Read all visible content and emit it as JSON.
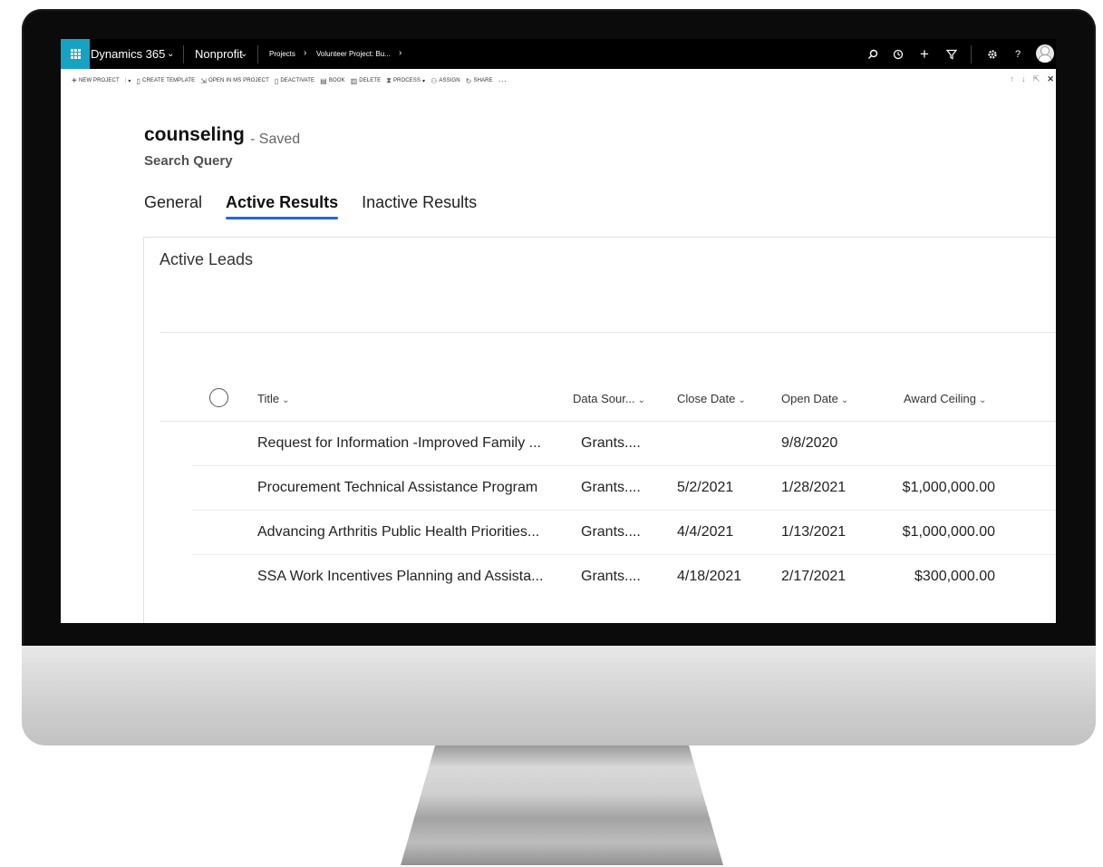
{
  "nav": {
    "app_name": "Dynamics 365",
    "area": "Nonprofit",
    "breadcrumb_1": "Projects",
    "breadcrumb_2": "Volunteer Project: Bu...",
    "sep": "›"
  },
  "commands": [
    {
      "label": "NEW PROJECT",
      "icon": "plus-icon"
    },
    {
      "label": "CREATE TEMPLATE",
      "icon": "document-icon"
    },
    {
      "label": "OPEN IN MS PROJECT",
      "icon": "open-file-icon"
    },
    {
      "label": "DEACTIVATE",
      "icon": "deactivate-icon"
    },
    {
      "label": "BOOK",
      "icon": "book-icon"
    },
    {
      "label": "DELETE",
      "icon": "trash-icon"
    },
    {
      "label": "PROCESS",
      "icon": "process-icon"
    },
    {
      "label": "ASSIGN",
      "icon": "assign-icon"
    },
    {
      "label": "SHARE",
      "icon": "share-icon"
    }
  ],
  "record": {
    "title": "counseling",
    "status": "- Saved",
    "entity": "Search Query"
  },
  "tabs": [
    "General",
    "Active Results",
    "Inactive Results"
  ],
  "section": {
    "title": "Active Leads"
  },
  "grid": {
    "columns": [
      "Title",
      "Data Sour...",
      "Close Date",
      "Open Date",
      "Award Ceiling"
    ],
    "rows": [
      {
        "title": "Request for Information -Improved Family ...",
        "source": "Grants....",
        "close": "",
        "open": "9/8/2020",
        "ceiling": ""
      },
      {
        "title": "Procurement Technical Assistance Program",
        "source": "Grants....",
        "close": "5/2/2021",
        "open": "1/28/2021",
        "ceiling": "$1,000,000.00"
      },
      {
        "title": "Advancing Arthritis Public Health Priorities...",
        "source": "Grants....",
        "close": "4/4/2021",
        "open": "1/13/2021",
        "ceiling": "$1,000,000.00"
      },
      {
        "title": "SSA Work Incentives Planning and Assista...",
        "source": "Grants....",
        "close": "4/18/2021",
        "open": "2/17/2021",
        "ceiling": "$300,000.00"
      }
    ]
  },
  "colors": {
    "accent": "#2266e3",
    "waffle": "#17a2c4",
    "nav_bg": "#000000"
  }
}
